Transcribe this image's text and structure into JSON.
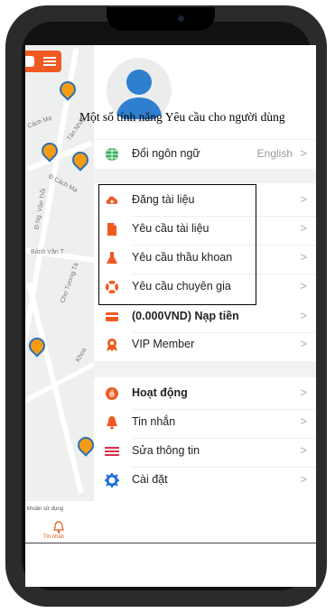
{
  "drawer": {
    "headline": "Một số tính năng Yêu cầu cho người dùng",
    "language": {
      "label": "Đổi ngôn ngữ",
      "value": "English"
    },
    "group1": [
      {
        "label": "Đăng tài liệu",
        "icon": "cloud-upload-icon",
        "color": "#f05a22"
      },
      {
        "label": "Yêu cầu tài liệu",
        "icon": "document-icon",
        "color": "#f05a22"
      },
      {
        "label": "Yêu cầu thầu khoan",
        "icon": "flask-icon",
        "color": "#f05a22"
      },
      {
        "label": "Yêu cầu chuyên gia",
        "icon": "lifebuoy-icon",
        "color": "#f05a22"
      }
    ],
    "group2": [
      {
        "label": "(0.000VND) Nạp tiền",
        "icon": "card-icon"
      },
      {
        "label": "VIP Member",
        "icon": "vip-badge-icon"
      }
    ],
    "group3": [
      {
        "label": "Hoạt động",
        "icon": "activity-icon"
      },
      {
        "label": "Tin nhắn",
        "icon": "bell-icon"
      },
      {
        "label": "Sửa thông tin",
        "icon": "edit-lines-icon"
      },
      {
        "label": "Cài đặt",
        "icon": "gear-icon"
      }
    ]
  },
  "map": {
    "streets": [
      "Tân Nhất",
      "Cách Mạ",
      "Đ Cách Mạ",
      "Bành Văn T",
      "Chợ Tương Tà",
      "Khoa",
      "Đ Ng. Văn Trỗi"
    ],
    "bottom_small": "khoản sử dụng",
    "bottom_tab": "Tin nhắn"
  },
  "colors": {
    "accent": "#f05a22",
    "blue": "#1e6fd9"
  }
}
